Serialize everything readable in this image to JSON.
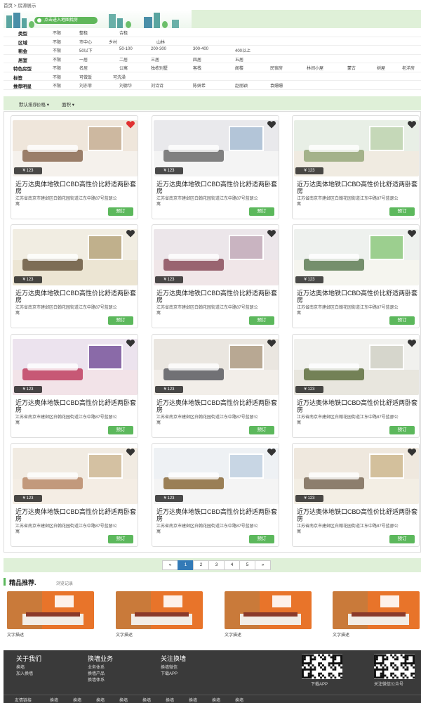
{
  "breadcrumb": "首页 > 房源展示",
  "banner": {
    "button": "点击进入地图找房"
  },
  "filters": [
    {
      "label": "类型",
      "options": [
        "不限",
        "整租",
        "合租"
      ]
    },
    {
      "label": "区域",
      "options": [
        "不限",
        "市中心",
        "乡村",
        "山林"
      ]
    },
    {
      "label": "租金",
      "options": [
        "不限",
        "50以下",
        "50-100",
        "200-300",
        "300-400",
        "400以上"
      ]
    },
    {
      "label": "居室",
      "options": [
        "不限",
        "一居",
        "二居",
        "三居",
        "四居",
        "五居"
      ]
    },
    {
      "label": "特色房型",
      "options": [
        "不限",
        "名居",
        "公寓",
        "独栋别墅",
        "客栈",
        "阁楼",
        "民宿房",
        "林间小屋",
        "蒙古",
        "树屋",
        "老洋房"
      ]
    },
    {
      "label": "标签",
      "options": [
        "不限",
        "可做饭",
        "可洗澡"
      ]
    },
    {
      "label": "推荐明星",
      "options": [
        "不限",
        "刘亦菲",
        "刘德华",
        "刘诗诗",
        "陈妍希",
        "赵丽颖",
        "袁姗姗"
      ]
    }
  ],
  "sort": [
    "默认排序",
    "价格 ▾",
    "面积 ▾"
  ],
  "listing": {
    "price": "¥ 123",
    "title": "近万达奥体地铁口CBD高性价比舒适两卧套房",
    "address": "江苏省南京市建邺区白翰花园街道江东中路87号蓝瑟公寓",
    "book": "预订"
  },
  "cards": [
    {
      "fav": true
    },
    {
      "fav": false
    },
    {
      "fav": false
    },
    {
      "fav": false
    },
    {
      "fav": false
    },
    {
      "fav": false
    },
    {
      "fav": false
    },
    {
      "fav": false
    },
    {
      "fav": false
    },
    {
      "fav": false
    },
    {
      "fav": false
    },
    {
      "fav": false
    }
  ],
  "pagination": [
    "«",
    "1",
    "2",
    "3",
    "4",
    "5",
    "»"
  ],
  "pagination_active": "1",
  "recommend": {
    "title": "精品推荐.",
    "subtitle": "浏览记录",
    "items": [
      "文字描述",
      "文字描述",
      "文字描述",
      "文字描述"
    ]
  },
  "footer": {
    "columns": [
      {
        "title": "关于我们",
        "items": [
          "换墙",
          "加入换墙"
        ]
      },
      {
        "title": "换墙业务",
        "items": [
          "业务体系",
          "换墙产品",
          "换墙体系"
        ]
      },
      {
        "title": "关注换墙",
        "items": [
          "换墙微信",
          "下载APP"
        ]
      }
    ],
    "qr_captions": [
      "下载APP",
      "关注微信公众号"
    ],
    "links_label": "友情链接",
    "links": [
      "换墙",
      "换墙",
      "换墙",
      "换墙",
      "换墙",
      "换墙",
      "换墙",
      "换墙",
      "换墙"
    ]
  },
  "colors": {
    "accent": "#5cb85c",
    "tint": "#dff0d8",
    "pager_active": "#337ab7",
    "footer": "#3a3a3a",
    "fav": "#e03030"
  }
}
